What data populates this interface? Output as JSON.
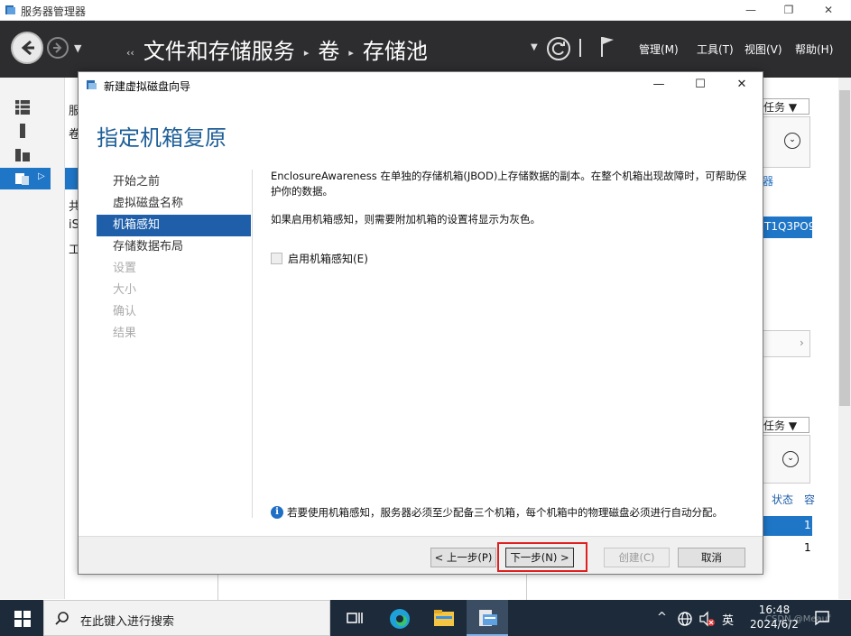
{
  "window": {
    "title": "服务器管理器",
    "controls": [
      "—",
      "❐",
      "✕"
    ]
  },
  "header": {
    "breadcrumb": [
      "文件和存储服务",
      "卷",
      "存储池"
    ],
    "menu": [
      "管理(M)",
      "工具(T)",
      "视图(V)",
      "帮助(H)"
    ]
  },
  "side_partial": [
    "服",
    "卷",
    "共",
    "iS",
    "工"
  ],
  "right_partial": {
    "tasks1": "任务 ▼",
    "tasks2": "任务 ▼",
    "frag1": "器",
    "frag2": "T1Q3PO9",
    "col_status": "状态",
    "col_extra": "容",
    "val1": "1",
    "val2": "1"
  },
  "wizard": {
    "title": "新建虚拟磁盘向导",
    "heading": "指定机箱复原",
    "steps": [
      {
        "label": "开始之前",
        "state": "normal"
      },
      {
        "label": "虚拟磁盘名称",
        "state": "normal"
      },
      {
        "label": "机箱感知",
        "state": "active"
      },
      {
        "label": "存储数据布局",
        "state": "normal"
      },
      {
        "label": "设置",
        "state": "disabled"
      },
      {
        "label": "大小",
        "state": "disabled"
      },
      {
        "label": "确认",
        "state": "disabled"
      },
      {
        "label": "结果",
        "state": "disabled"
      }
    ],
    "para1": "EnclosureAwareness 在单独的存储机箱(JBOD)上存储数据的副本。在整个机箱出现故障时，可帮助保护你的数据。",
    "para2": "如果启用机箱感知，则需要附加机箱的设置将显示为灰色。",
    "checkbox_label": "启用机箱感知(E)",
    "checkbox_checked": false,
    "info_text": "若要使用机箱感知，服务器必须至少配备三个机箱，每个机箱中的物理磁盘必须进行自动分配。",
    "buttons": {
      "prev": "< 上一步(P)",
      "next": "下一步(N) >",
      "create": "创建(C)",
      "cancel": "取消"
    },
    "highlight_color": "#e02020"
  },
  "taskbar": {
    "search_placeholder": "在此键入进行搜索",
    "ime": "英",
    "time": "16:48",
    "date": "2024/6/2",
    "watermark": "CSDN @Meauf"
  },
  "colors": {
    "accent": "#1f5fa9",
    "header_bg": "#2d2d30",
    "heading": "#1e5f98",
    "taskbar": "#1c2a3a"
  }
}
